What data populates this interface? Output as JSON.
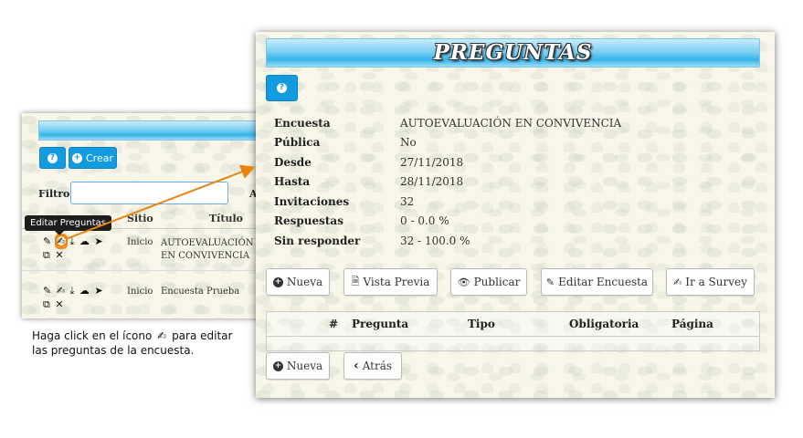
{
  "back_panel": {
    "help_label": "?",
    "create_button": "Crear",
    "filter_label": "Filtro",
    "col_a": "A",
    "headers": {
      "site": "Sitio",
      "title": "Título"
    },
    "tooltip": "Editar Preguntas",
    "rows": [
      {
        "site": "Inicio",
        "title": "AUTOEVALUACIÓN EN CONVIVENCIA"
      },
      {
        "site": "Inicio",
        "title": "Encuesta Prueba"
      }
    ],
    "row_icons": {
      "edit_pencil": "✎",
      "edit_questions": "✍",
      "download": "⤓",
      "cloud": "☁",
      "send": "➤",
      "copy": "⧉",
      "delete": "✕"
    }
  },
  "caption": {
    "before_icon": "Haga click en el ícono",
    "after_icon": "para editar las preguntas de la encuesta.",
    "icon": "✍"
  },
  "main": {
    "title": "PREGUNTAS",
    "help_label": "?",
    "details": [
      {
        "label": "Encuesta",
        "value": "AUTOEVALUACIÓN EN CONVIVENCIA"
      },
      {
        "label": "Pública",
        "value": "No"
      },
      {
        "label": "Desde",
        "value": "27/11/2018"
      },
      {
        "label": "Hasta",
        "value": "28/11/2018"
      },
      {
        "label": "Invitaciones",
        "value": "32"
      },
      {
        "label": "Respuestas",
        "value": "0  -  0.0 %"
      },
      {
        "label": "Sin responder",
        "value": "32  -  100.0 %"
      }
    ],
    "actions": {
      "new": "Nueva",
      "preview": "Vista Previa",
      "publish": "Publicar",
      "edit_survey": "Editar Encuesta",
      "go_survey": "Ir a Survey"
    },
    "table_headers": {
      "num": "#",
      "question": "Pregunta",
      "type": "Tipo",
      "required": "Obligatoria",
      "page": "Página"
    },
    "bottom": {
      "new": "Nueva",
      "back": "Atrás"
    },
    "icons": {
      "plus": "+",
      "file": "🗎",
      "eye": "👁",
      "pencil": "✎",
      "edit": "✍",
      "chevron_left": "‹"
    }
  }
}
